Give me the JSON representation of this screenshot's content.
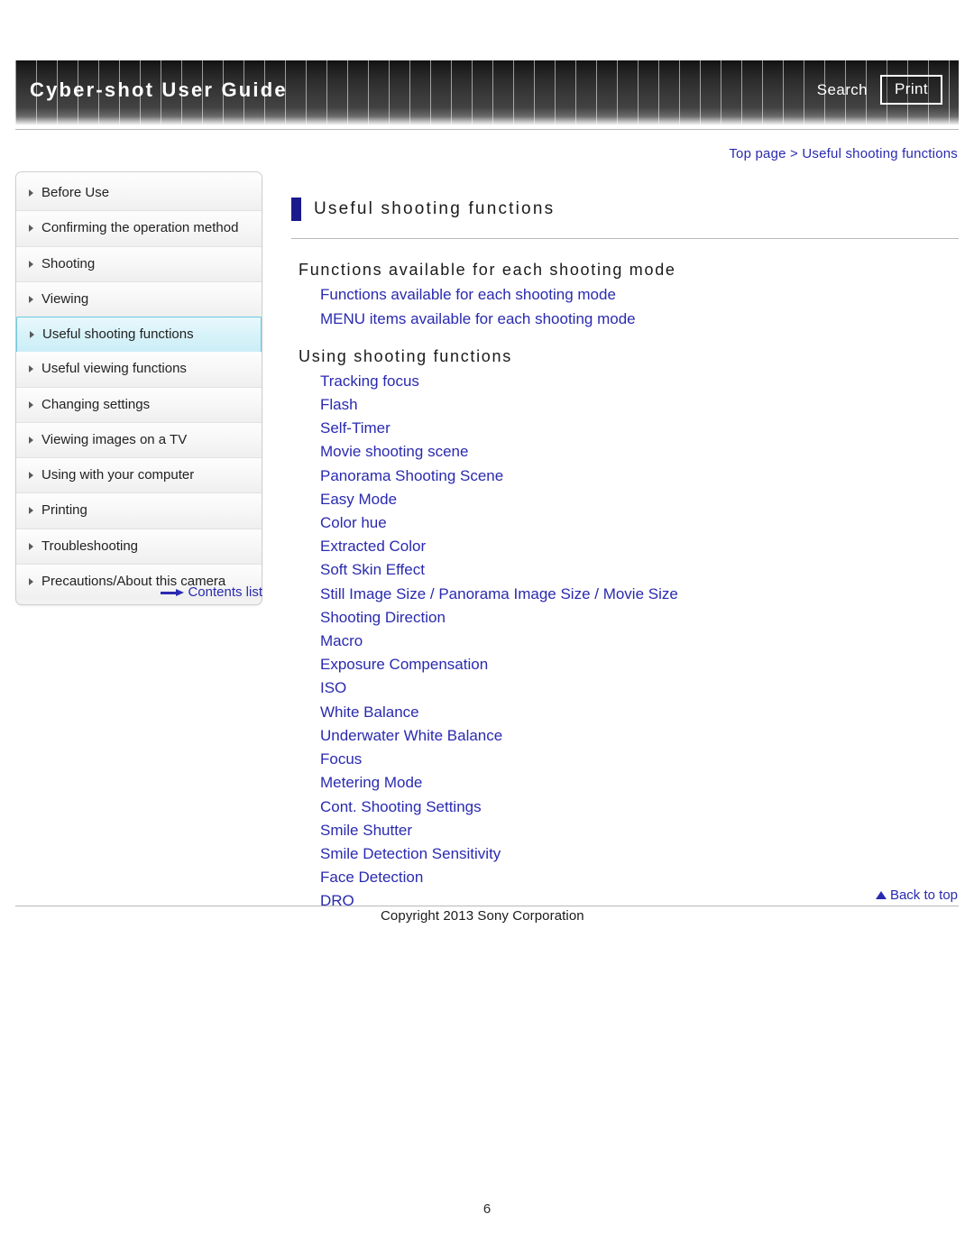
{
  "header": {
    "title": "Cyber-shot User Guide",
    "search_label": "Search",
    "print_label": "Print"
  },
  "breadcrumb": {
    "root": "Top page",
    "separator": ">",
    "current": "Useful shooting functions",
    "full": "Top page > Useful shooting functions"
  },
  "sidebar": {
    "items": [
      {
        "label": "Before Use",
        "active": false
      },
      {
        "label": "Confirming the operation method",
        "active": false
      },
      {
        "label": "Shooting",
        "active": false
      },
      {
        "label": "Viewing",
        "active": false
      },
      {
        "label": "Useful shooting functions",
        "active": true
      },
      {
        "label": "Useful viewing functions",
        "active": false
      },
      {
        "label": "Changing settings",
        "active": false
      },
      {
        "label": "Viewing images on a TV",
        "active": false
      },
      {
        "label": "Using with your computer",
        "active": false
      },
      {
        "label": "Printing",
        "active": false
      },
      {
        "label": "Troubleshooting",
        "active": false
      },
      {
        "label": "Precautions/About this camera",
        "active": false
      }
    ],
    "contents_list_label": "Contents list"
  },
  "main": {
    "page_title": "Useful shooting functions",
    "sections": [
      {
        "heading": "Functions available for each shooting mode",
        "links": [
          "Functions available for each shooting mode",
          "MENU items available for each shooting mode"
        ]
      },
      {
        "heading": "Using shooting functions",
        "links": [
          "Tracking focus",
          "Flash",
          "Self-Timer",
          "Movie shooting scene",
          "Panorama Shooting Scene",
          "Easy Mode",
          "Color hue",
          "Extracted Color",
          "Soft Skin Effect",
          "Still Image Size / Panorama Image Size / Movie Size",
          "Shooting Direction",
          "Macro",
          "Exposure Compensation",
          "ISO",
          "White Balance",
          "Underwater White Balance",
          "Focus",
          "Metering Mode",
          "Cont. Shooting Settings",
          "Smile Shutter",
          "Smile Detection Sensitivity",
          "Face Detection",
          "DRO"
        ]
      }
    ]
  },
  "footer": {
    "back_to_top_label": "Back to top",
    "copyright": "Copyright 2013 Sony Corporation",
    "page_number": "6"
  },
  "colors": {
    "link": "#2a2ab0",
    "accent_bar": "#1a1a8c",
    "active_nav_bg": "#d6f2f9",
    "active_nav_border": "#69c9e0",
    "header_dark": "#1b1b1b"
  },
  "icons": {
    "caret": "nav-caret-icon",
    "arrow_right": "arrow-right-icon",
    "triangle_up": "triangle-up-icon"
  }
}
